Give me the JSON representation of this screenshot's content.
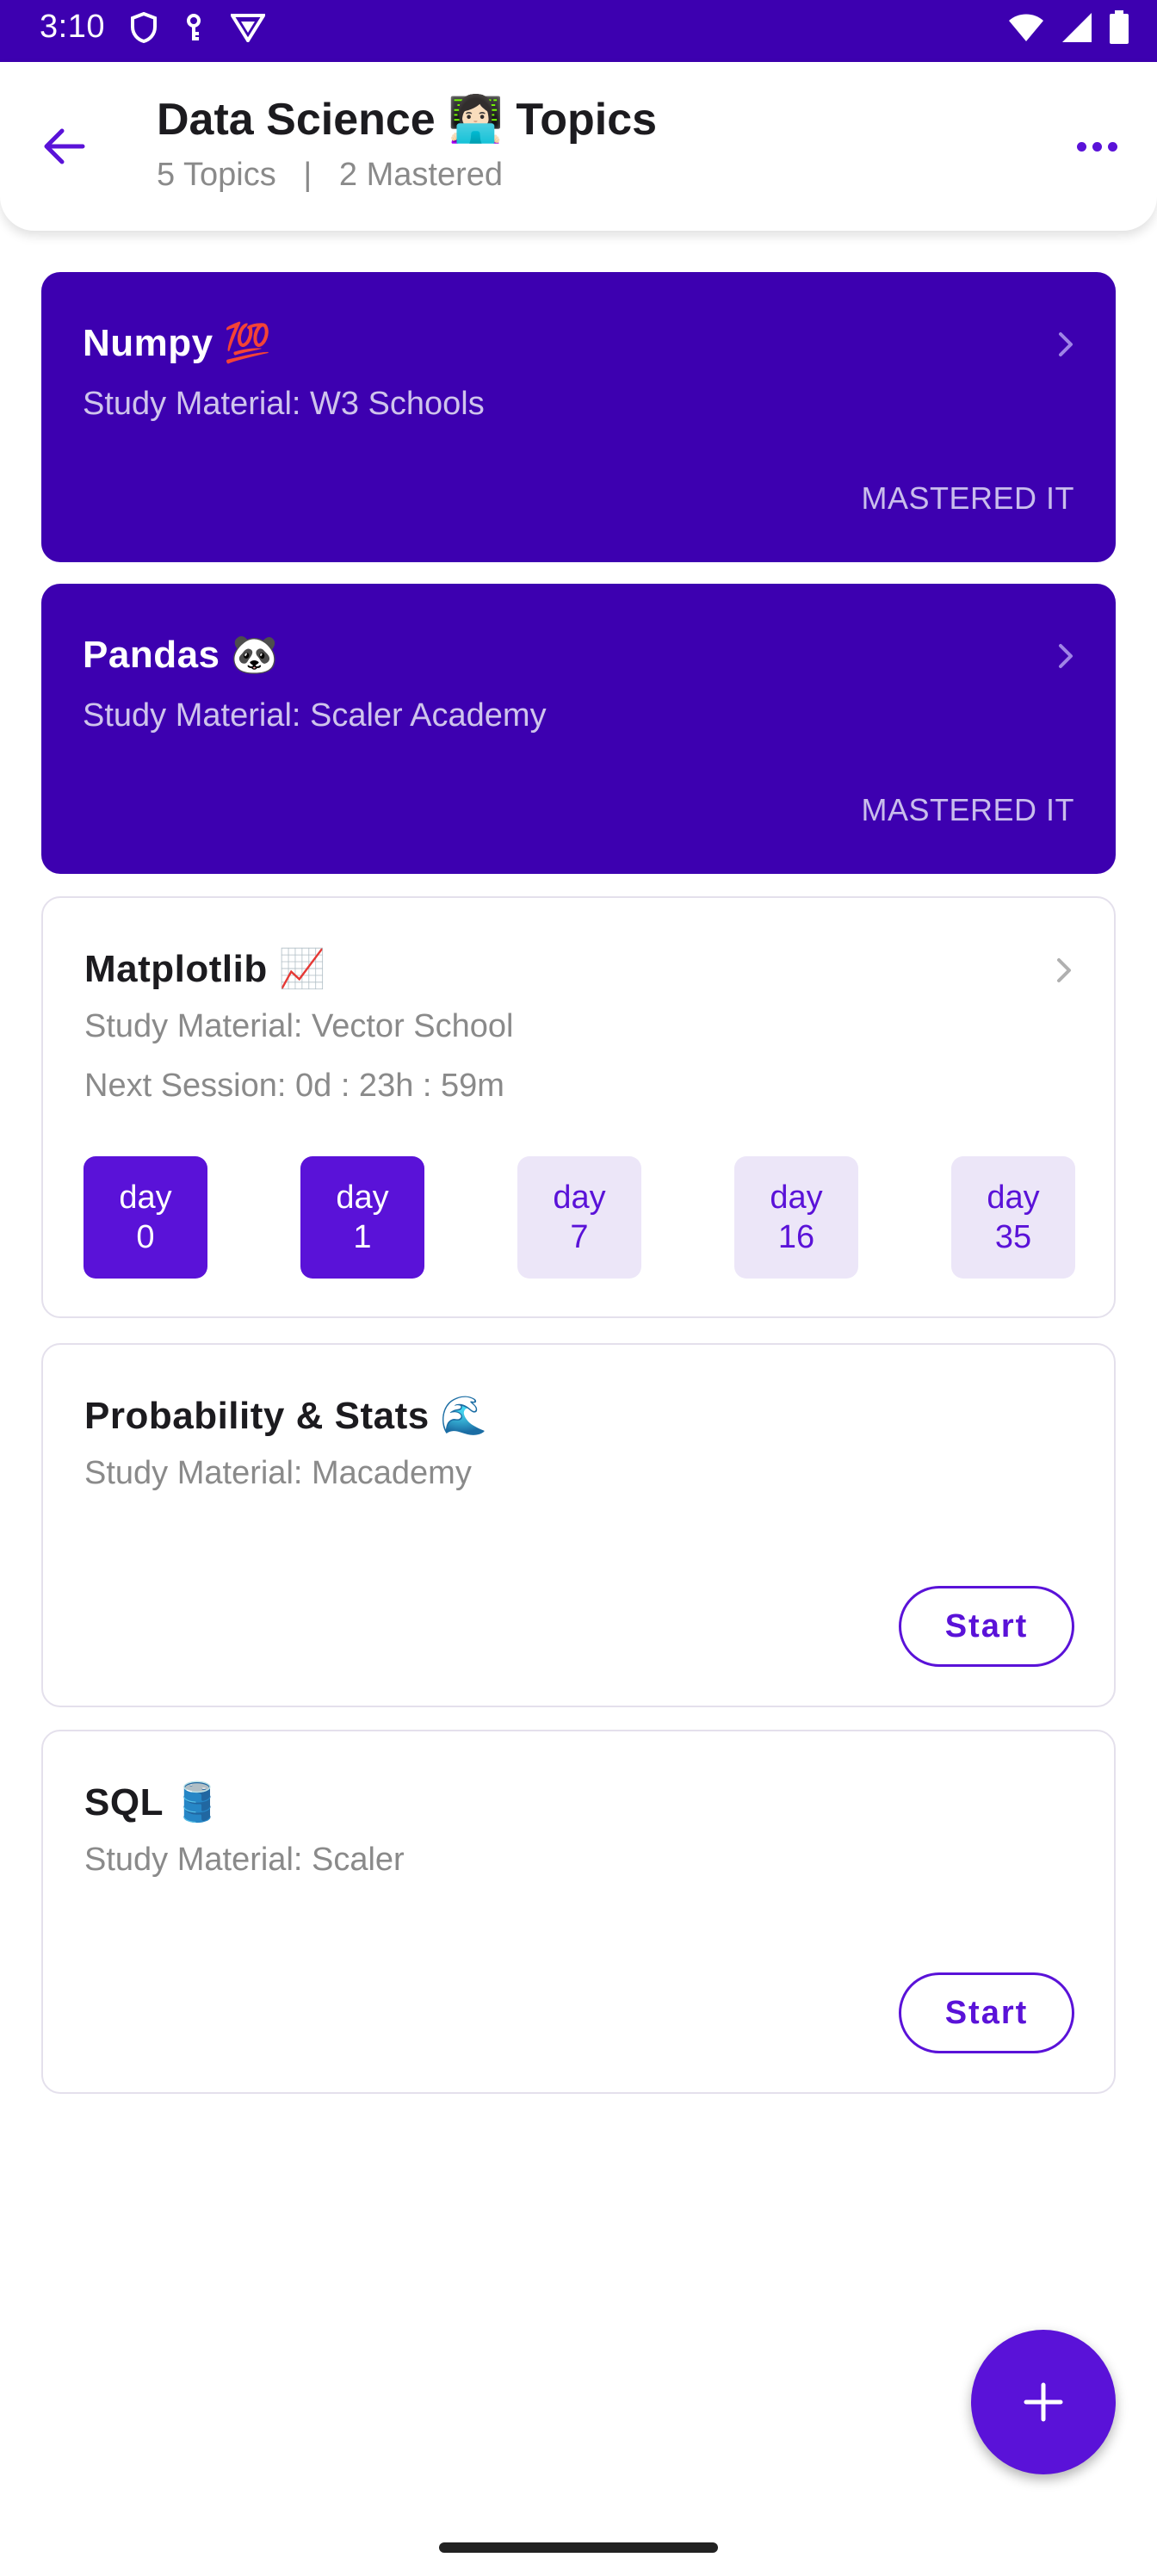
{
  "status_bar": {
    "time": "3:10"
  },
  "app_bar": {
    "title": "Data Science 👩🏻‍💻 Topics",
    "subtitle": "5 Topics   |   2 Mastered"
  },
  "topics": [
    {
      "title": "Numpy 💯",
      "material": "Study Material: W3 Schools",
      "status": "MASTERED IT"
    },
    {
      "title": "Pandas 🐼",
      "material": "Study Material: Scaler Academy",
      "status": "MASTERED IT"
    },
    {
      "title": "Matplotlib 📈",
      "material": "Study Material: Vector School",
      "next_session": "Next Session: 0d : 23h : 59m",
      "days": [
        {
          "label": "day",
          "num": "0",
          "done": true
        },
        {
          "label": "day",
          "num": "1",
          "done": true
        },
        {
          "label": "day",
          "num": "7",
          "done": false
        },
        {
          "label": "day",
          "num": "16",
          "done": false
        },
        {
          "label": "day",
          "num": "35",
          "done": false
        }
      ]
    },
    {
      "title": "Probability & Stats 🌊",
      "material": "Study Material: Macademy",
      "action": "Start"
    },
    {
      "title": "SQL 🛢️",
      "material": "Study Material: Scaler",
      "action": "Start"
    }
  ],
  "colors": {
    "primary": "#3d00b0",
    "accent": "#5a12d8",
    "chip_pending": "#ece6f8"
  }
}
